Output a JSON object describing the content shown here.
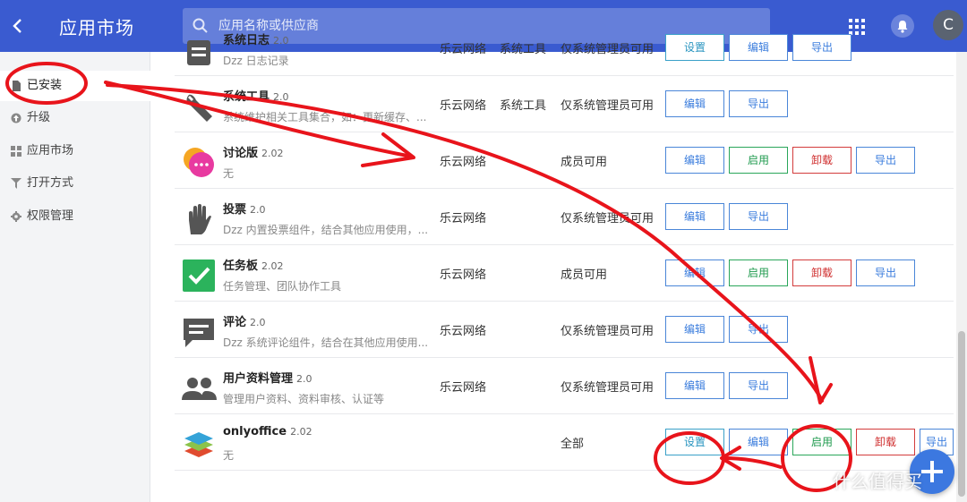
{
  "header": {
    "back_icon": "chevron-left-icon",
    "title": "应用市场",
    "search_placeholder": "应用名称或供应商",
    "avatar_letter": "C",
    "accent_color": "#3a5bd0"
  },
  "sidebar": {
    "items": [
      {
        "label": "已安装",
        "icon": "file-icon",
        "active": true
      },
      {
        "label": "升级",
        "icon": "upgrade-icon"
      },
      {
        "label": "应用市场",
        "icon": "grid-icon"
      },
      {
        "label": "打开方式",
        "icon": "filter-icon"
      },
      {
        "label": "权限管理",
        "icon": "gear-icon"
      }
    ]
  },
  "apps": [
    {
      "name": "系统日志",
      "version": "2.0",
      "desc": "Dzz 日志记录",
      "vendor": "乐云网络",
      "category": "系统工具",
      "permission": "仅系统管理员可用",
      "buttons": [
        "设置",
        "编辑",
        "导出"
      ]
    },
    {
      "name": "系统工具",
      "version": "2.0",
      "desc": "系统维护相关工具集合，如：更新缓存、...",
      "vendor": "乐云网络",
      "category": "系统工具",
      "permission": "仅系统管理员可用",
      "buttons": [
        "编辑",
        "导出"
      ]
    },
    {
      "name": "讨论版",
      "version": "2.02",
      "desc": "无",
      "vendor": "乐云网络",
      "category": "",
      "permission": "成员可用",
      "buttons": [
        "编辑",
        "启用",
        "卸载",
        "导出"
      ]
    },
    {
      "name": "投票",
      "version": "2.0",
      "desc": "Dzz 内置投票组件，结合其他应用使用，...",
      "vendor": "乐云网络",
      "category": "",
      "permission": "仅系统管理员可用",
      "buttons": [
        "编辑",
        "导出"
      ]
    },
    {
      "name": "任务板",
      "version": "2.02",
      "desc": "任务管理、团队协作工具",
      "vendor": "乐云网络",
      "category": "",
      "permission": "成员可用",
      "buttons": [
        "编辑",
        "启用",
        "卸载",
        "导出"
      ]
    },
    {
      "name": "评论",
      "version": "2.0",
      "desc": "Dzz 系统评论组件，结合在其他应用使用...",
      "vendor": "乐云网络",
      "category": "",
      "permission": "仅系统管理员可用",
      "buttons": [
        "编辑",
        "导出"
      ]
    },
    {
      "name": "用户资料管理",
      "version": "2.0",
      "desc": "管理用户资料、资料审核、认证等",
      "vendor": "乐云网络",
      "category": "",
      "permission": "仅系统管理员可用",
      "buttons": [
        "编辑",
        "导出"
      ]
    },
    {
      "name": "onlyoffice",
      "version": "2.02",
      "desc": "无",
      "vendor": "",
      "category": "",
      "permission": "全部",
      "buttons": [
        "设置",
        "编辑",
        "启用",
        "卸载",
        "导出"
      ]
    }
  ],
  "watermark": "什么值得买",
  "annotation_color": "#e8141b"
}
